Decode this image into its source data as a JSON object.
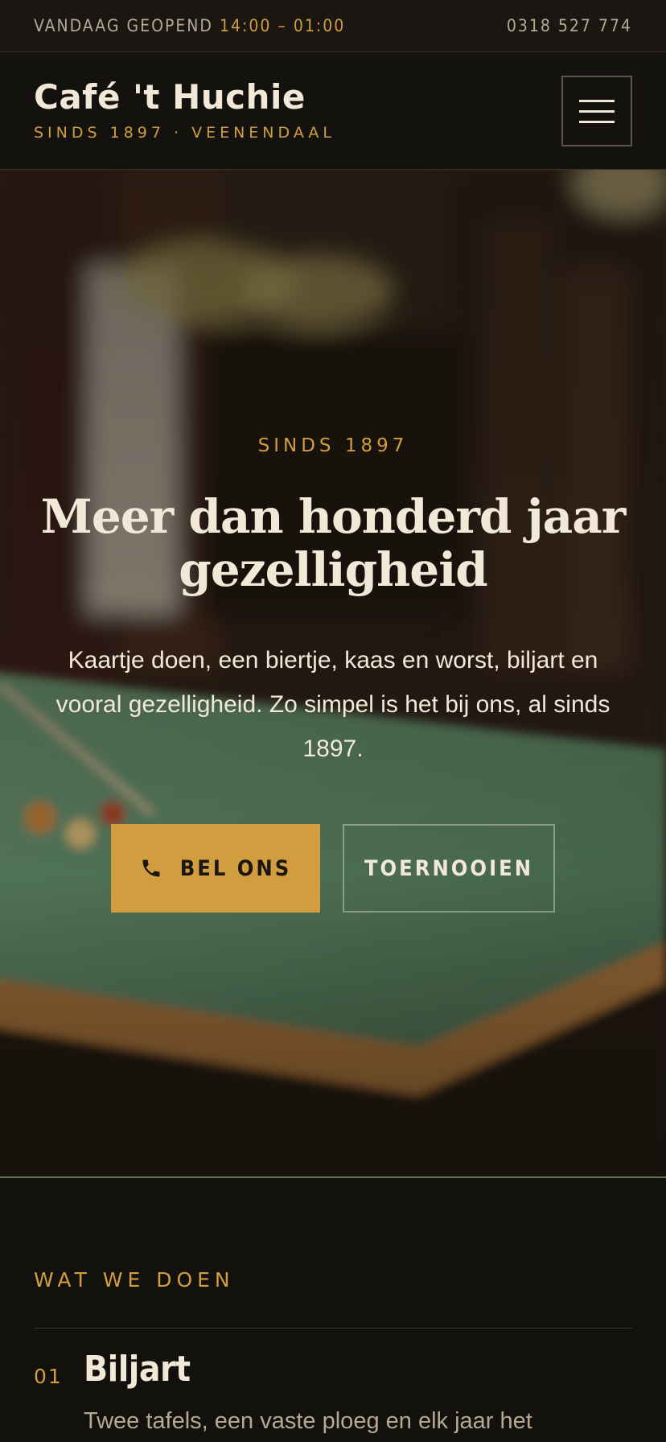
{
  "topbar": {
    "open_label": "VANDAAG GEOPEND",
    "hours": "14:00 – 01:00",
    "phone": "0318 527 774"
  },
  "header": {
    "brand_name": "Café 't Huchie",
    "brand_sub": "SINDS 1897 · VEENENDAAL",
    "menu_icon": "hamburger-icon"
  },
  "hero": {
    "eyebrow": "SINDS 1897",
    "title": "Meer dan honderd jaar gezelligheid",
    "text": "Kaartje doen, een biertje, kaas en worst, biljart en vooral gezelligheid. Zo simpel is het bij ons, al sinds 1897.",
    "call_button": "BEL ONS",
    "call_icon": "phone-icon",
    "tournaments_button": "TOERNOOIEN"
  },
  "services": {
    "label": "WAT WE DOEN",
    "items": [
      {
        "number": "01",
        "title": "Biljart",
        "description": "Twee tafels, een vaste ploeg en elk jaar het"
      }
    ]
  },
  "colors": {
    "accent": "#d29d3f",
    "background": "#13110d",
    "text": "#f2e8d8",
    "felt": "#5f8f6b"
  }
}
